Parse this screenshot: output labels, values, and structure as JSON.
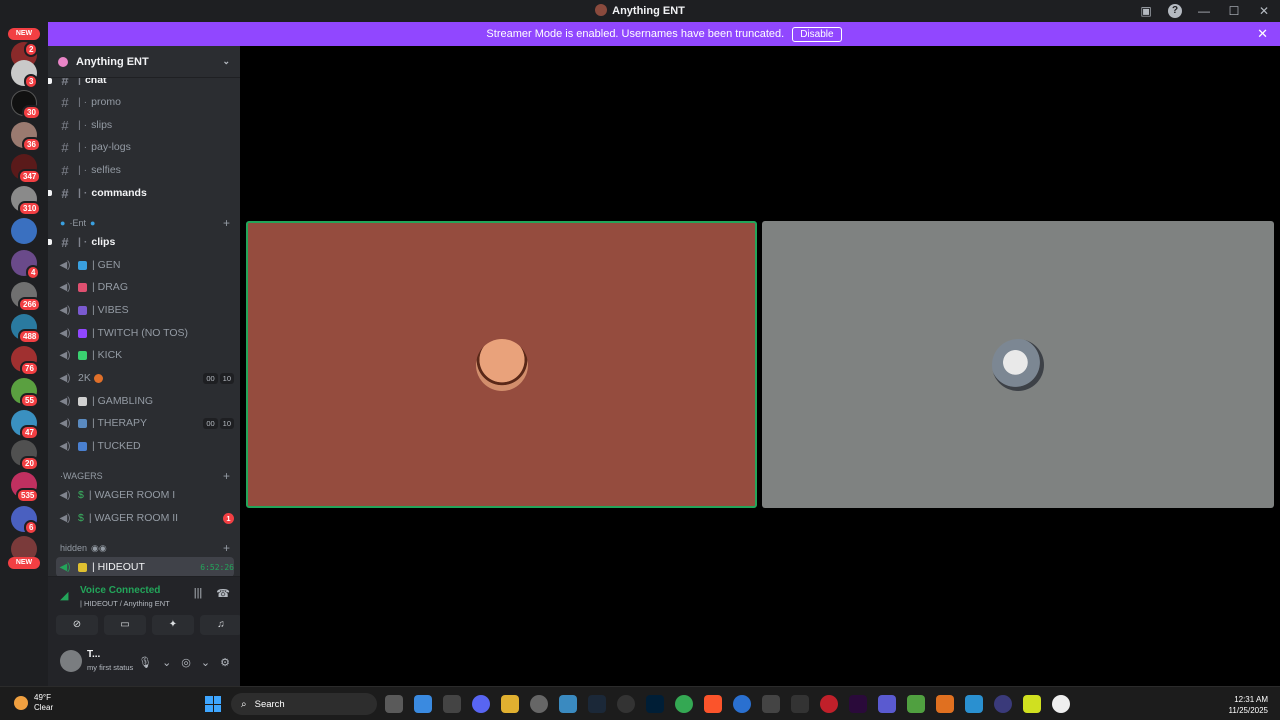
{
  "window": {
    "title": "Anything ENT"
  },
  "banner": {
    "text": "Streamer Mode is enabled. Usernames have been truncated.",
    "disable_label": "Disable"
  },
  "server_rail": {
    "top_pill": "NEW",
    "bottom_pill": "NEW",
    "badges": [
      "2",
      "3",
      "30",
      "36",
      "347",
      "310",
      "4",
      "266",
      "488",
      "76",
      "55",
      "47",
      "20",
      "535",
      "6"
    ]
  },
  "guild": {
    "name": "Anything ENT"
  },
  "channels": {
    "text_top": [
      "chat",
      "promo",
      "slips",
      "pay-logs",
      "selfies",
      "commands"
    ],
    "category_ent": "Ent",
    "clips": "clips",
    "voice": [
      {
        "label": "| GEN"
      },
      {
        "label": "| DRAG"
      },
      {
        "label": "| VIBES"
      },
      {
        "label": "| TWITCH (NO TOS)"
      },
      {
        "label": "| KICK"
      },
      {
        "label": "2K",
        "counts": [
          "00",
          "10"
        ]
      },
      {
        "label": "| GAMBLING"
      },
      {
        "label": "| THERAPY",
        "counts": [
          "00",
          "10"
        ]
      },
      {
        "label": "| TUCKED"
      }
    ],
    "category_wagers": "WAGERS",
    "wagers": [
      {
        "label": "| WAGER ROOM I"
      },
      {
        "label": "| WAGER ROOM II",
        "ping": "1"
      }
    ],
    "category_hidden": "hidden",
    "hideout": {
      "label": "| HIDEOUT",
      "timer": "6:52:26"
    }
  },
  "voice_panel": {
    "status": "Voice Connected",
    "sub": "| HIDEOUT / Anything ENT"
  },
  "user_panel": {
    "name": "T...",
    "status": "my first status"
  },
  "taskbar": {
    "temp": "49°F",
    "condition": "Clear",
    "search": "Search",
    "time": "12:31 AM",
    "date": "11/25/2025"
  }
}
